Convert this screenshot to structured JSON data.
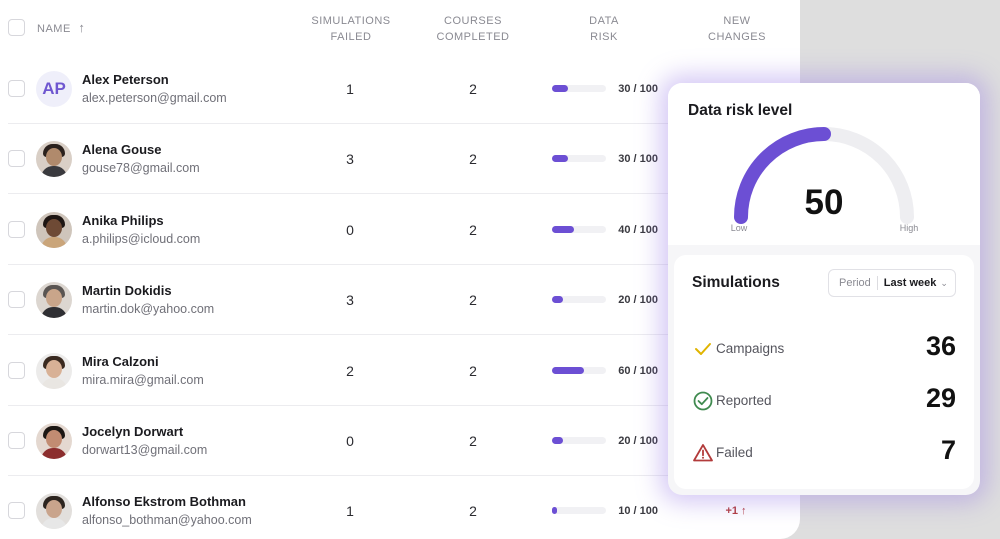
{
  "table": {
    "headers": {
      "name": "NAME",
      "sort_arrow": "↑",
      "simulations_failed": [
        "SIMULATIONS",
        "FAILED"
      ],
      "courses_completed": [
        "COURSES",
        "COMPLETED"
      ],
      "data_risk": [
        "DATA",
        "RISK"
      ],
      "new_changes": [
        "NEW",
        "CHANGES"
      ]
    },
    "rows": [
      {
        "avatar": "AP",
        "name": "Alex Peterson",
        "email": "alex.peterson@gmail.com",
        "simulations_failed": "1",
        "courses_completed": "2",
        "risk": 30,
        "risk_label": "30 / 100",
        "changes": ""
      },
      {
        "avatar": "",
        "name": "Alena Gouse",
        "email": "gouse78@gmail.com",
        "simulations_failed": "3",
        "courses_completed": "2",
        "risk": 30,
        "risk_label": "30 / 100",
        "changes": ""
      },
      {
        "avatar": "",
        "name": "Anika Philips",
        "email": "a.philips@icloud.com",
        "simulations_failed": "0",
        "courses_completed": "2",
        "risk": 40,
        "risk_label": "40 / 100",
        "changes": ""
      },
      {
        "avatar": "",
        "name": "Martin Dokidis",
        "email": "martin.dok@yahoo.com",
        "simulations_failed": "3",
        "courses_completed": "2",
        "risk": 20,
        "risk_label": "20 / 100",
        "changes": ""
      },
      {
        "avatar": "",
        "name": "Mira Calzoni",
        "email": "mira.mira@gmail.com",
        "simulations_failed": "2",
        "courses_completed": "2",
        "risk": 60,
        "risk_label": "60 / 100",
        "changes": ""
      },
      {
        "avatar": "",
        "name": "Jocelyn Dorwart",
        "email": "dorwart13@gmail.com",
        "simulations_failed": "0",
        "courses_completed": "2",
        "risk": 20,
        "risk_label": "20 / 100",
        "changes": ""
      },
      {
        "avatar": "",
        "name": "Alfonso Ekstrom Bothman",
        "email": "alfonso_bothman@yahoo.com",
        "simulations_failed": "1",
        "courses_completed": "2",
        "risk": 10,
        "risk_label": "10 / 100",
        "changes": "+1 ↑"
      }
    ]
  },
  "risk_card": {
    "title": "Data risk level",
    "value": "50",
    "level": 50,
    "low_label": "Low",
    "high_label": "High",
    "accent": "#6c4fd4",
    "track": "#eeeef1"
  },
  "simulations_card": {
    "title": "Simulations",
    "period_label": "Period",
    "period_value": "Last week",
    "stats": [
      {
        "icon": "check-icon",
        "label": "Campaigns",
        "value": "36",
        "color": "#e0b400"
      },
      {
        "icon": "check-circle-icon",
        "label": "Reported",
        "value": "29",
        "color": "#3f8a4f"
      },
      {
        "icon": "warning-icon",
        "label": "Failed",
        "value": "7",
        "color": "#b23b3b"
      }
    ]
  }
}
